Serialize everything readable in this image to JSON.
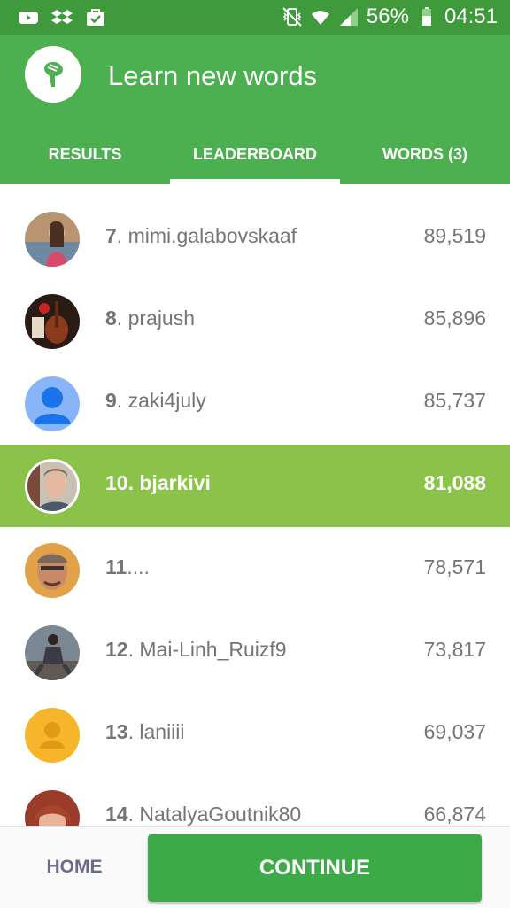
{
  "status_bar": {
    "battery": "56%",
    "time": "04:51",
    "icons": [
      "youtube-icon",
      "dropbox-icon",
      "briefcase-check-icon",
      "vibrate-mute-icon",
      "wifi-icon",
      "signal-icon",
      "battery-icon"
    ]
  },
  "header": {
    "logo_icon": "hand-logo-icon",
    "title": "Learn new words"
  },
  "tabs": [
    {
      "label": "RESULTS",
      "active": false
    },
    {
      "label": "LEADERBOARD",
      "active": true
    },
    {
      "label": "WORDS (3)",
      "active": false
    }
  ],
  "leaderboard": [
    {
      "rank": "7",
      "name": "mimi.galabovskaaf",
      "score": "89,519"
    },
    {
      "rank": "8",
      "name": "prajush",
      "score": "85,896"
    },
    {
      "rank": "9",
      "name": "zaki4july",
      "score": "85,737"
    },
    {
      "rank": "10",
      "name": "bjarkivi",
      "score": "81,088",
      "current_user": true
    },
    {
      "rank": "11",
      "name": "...",
      "score": "78,571"
    },
    {
      "rank": "12",
      "name": "Mai-Linh_Ruizf9",
      "score": "73,817"
    },
    {
      "rank": "13",
      "name": "laniiii",
      "score": "69,037"
    },
    {
      "rank": "14",
      "name": "NatalyaGoutnik80",
      "score": "66,874"
    }
  ],
  "footer": {
    "home_label": "HOME",
    "continue_label": "CONTINUE"
  },
  "colors": {
    "status_bar": "#3f9a3c",
    "app_bar": "#4caf50",
    "highlight_row": "#8bc34a",
    "continue_button": "#3daa48"
  }
}
